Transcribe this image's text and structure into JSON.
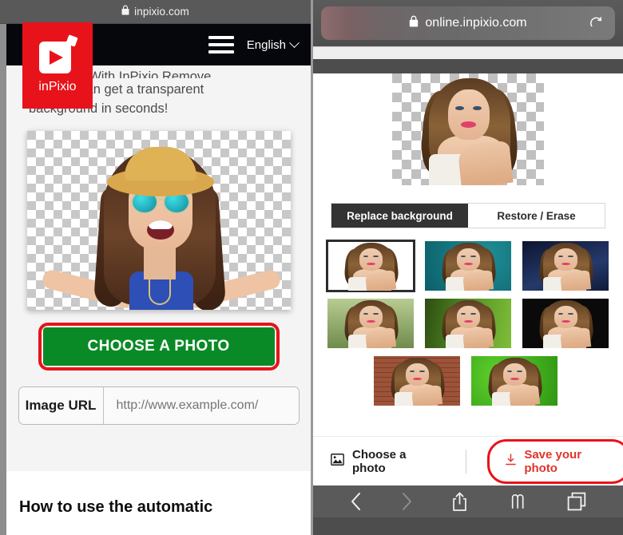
{
  "left": {
    "browser": {
      "url": "inpixio.com",
      "lock_icon": "lock-icon"
    },
    "nav": {
      "logo_text": "inPixio",
      "logo_icon": "inpixio-play-logo",
      "menu_icon": "hamburger-menu-icon",
      "language": "English",
      "language_chevron_icon": "chevron-down-icon"
    },
    "hero": {
      "line_clipped": "sh easier. With InPixio Remove",
      "line1": "und you can get a transparent",
      "line2": "background in seconds!",
      "photo_alt": "woman-with-hat-and-sunglasses-transparent-background"
    },
    "choose_button": {
      "label": "CHOOSE A PHOTO",
      "annotation_color": "#e8131a",
      "background_color": "#0a8a26"
    },
    "url_field": {
      "label": "Image URL",
      "value": "",
      "placeholder": "http://www.example.com/"
    },
    "howto_heading": "How to use the automatic"
  },
  "right": {
    "browser": {
      "url": "online.inpixio.com",
      "lock_icon": "lock-icon",
      "reload_icon": "reload-icon"
    },
    "preview_alt": "model-photo-transparent-checkerboard-background",
    "tabs": [
      {
        "label": "Replace background",
        "active": true
      },
      {
        "label": "Restore / Erase",
        "active": false
      }
    ],
    "thumbnails": [
      {
        "name": "white-background",
        "style": "bg-white",
        "selected": true
      },
      {
        "name": "teal-background",
        "style": "bg-teal",
        "selected": false
      },
      {
        "name": "night-sky-background",
        "style": "bg-night",
        "selected": false
      },
      {
        "name": "forest-background",
        "style": "bg-forest",
        "selected": false
      },
      {
        "name": "green-leaves-background",
        "style": "bg-leaf",
        "selected": false
      },
      {
        "name": "dark-background",
        "style": "bg-dark",
        "selected": false
      },
      {
        "name": "brick-wall-background",
        "style": "bg-brick",
        "selected": false
      },
      {
        "name": "grass-background",
        "style": "bg-grass",
        "selected": false
      }
    ],
    "footer": {
      "choose_label": "Choose a photo",
      "choose_icon": "image-icon",
      "save_label": "Save your photo",
      "save_icon": "download-icon",
      "save_color": "#e1342b",
      "annotation_color": "#e8131a"
    },
    "toolbar": {
      "back_icon": "back-chevron-icon",
      "forward_icon": "forward-chevron-icon",
      "share_icon": "share-icon",
      "bookmarks_icon": "bookmarks-icon",
      "tabs_icon": "tabs-icon"
    }
  }
}
